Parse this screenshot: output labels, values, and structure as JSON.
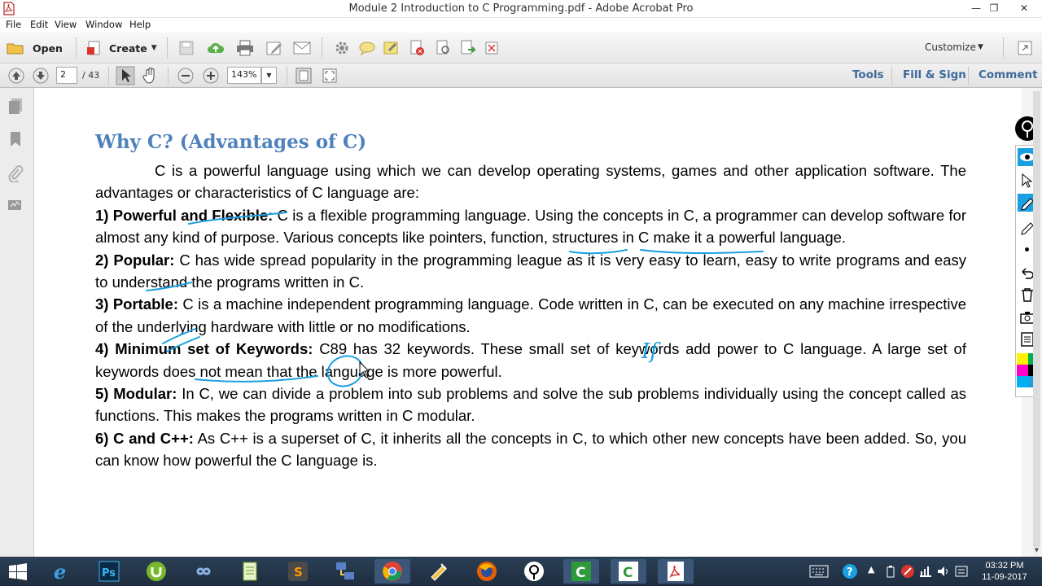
{
  "window": {
    "title": "Module 2 Introduction to C Programming.pdf - Adobe Acrobat Pro",
    "minimize": "—",
    "maximize": "❐",
    "close": "✕"
  },
  "menubar": [
    "File",
    "Edit",
    "View",
    "Window",
    "Help"
  ],
  "toolbar": {
    "open_label": "Open",
    "create_label": "Create",
    "customize_label": "Customize"
  },
  "nav": {
    "page_current": "2",
    "page_total": "/ 43",
    "zoom": "143%"
  },
  "panels": [
    "Tools",
    "Fill & Sign",
    "Comment"
  ],
  "document": {
    "heading": "Why C? (Advantages of C)",
    "intro": "C is a powerful language using which we can develop operating systems, games and other application software. The advantages or characteristics of C language are:",
    "points": [
      {
        "title": "1) Powerful and Flexible:",
        "text": " C is a flexible programming language. Using the concepts in C, a programmer can develop software for almost any kind of purpose. Various concepts like pointers, function, structures in C make it a powerful language."
      },
      {
        "title": "2) Popular:",
        "text": " C has wide spread popularity in the programming league as it is very easy to learn, easy to write programs and easy to understand the programs written in C."
      },
      {
        "title": "3) Portable:",
        "text": " C is a machine independent programming language. Code written in C, can be executed on any machine irrespective of the underlying hardware with little or no modifications."
      },
      {
        "title": "4) Minimum set of Keywords:",
        "text": " C89 has 32 keywords. These small set of keywords add power to C language. A large set of keywords does not mean that the language is more powerful."
      },
      {
        "title": "5) Modular:",
        "text": " In C, we can divide a problem into sub problems and solve the sub problems individually using the concept called as functions. This makes the programs written in C modular."
      },
      {
        "title": "6) C and C++:",
        "text": " As C++ is a superset of C, it inherits all the concepts in C, to which other new concepts have been added. So, you can know how powerful the C language is."
      }
    ],
    "handwritten_note": "If"
  },
  "taskbar": {
    "time": "03:32 PM",
    "date": "11-09-2017"
  },
  "colors": {
    "heading": "#4f81bd",
    "ink": "#1a9fe0",
    "panel_link": "#3d6a9a",
    "taskbar": "#1e2d3f"
  }
}
